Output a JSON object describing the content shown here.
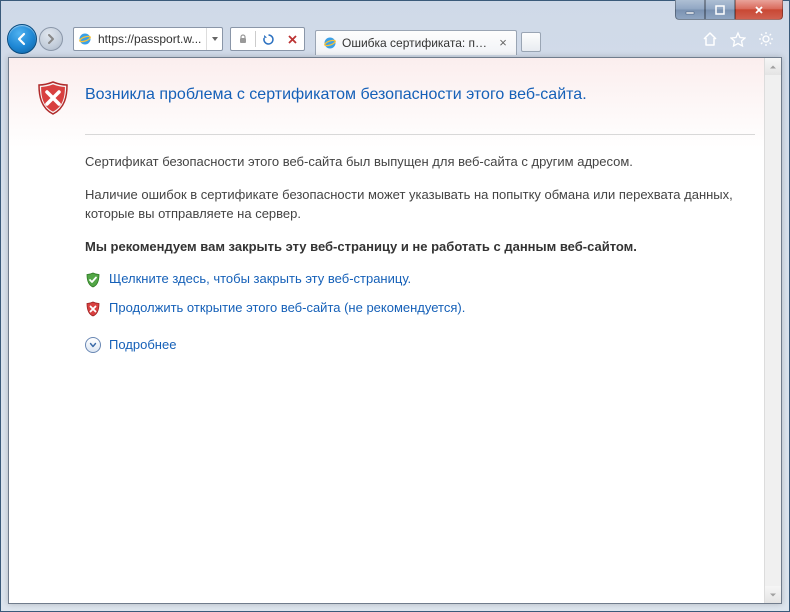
{
  "window": {
    "url": "https://passport.w...",
    "tab_title": "Ошибка сертификата: пер..."
  },
  "page": {
    "title": "Возникла проблема с сертификатом безопасности этого веб-сайта.",
    "paragraph1": "Сертификат безопасности этого веб-сайта был выпущен для веб-сайта с другим адресом.",
    "paragraph2": "Наличие ошибок в сертификате безопасности может указывать на попытку обмана или перехвата данных, которые вы отправляете на сервер.",
    "strong": "Мы рекомендуем вам закрыть эту веб-страницу и не работать с данным веб-сайтом.",
    "link_close": "Щелкните здесь, чтобы закрыть эту веб-страницу.",
    "link_continue": "Продолжить открытие этого веб-сайта (не рекомендуется).",
    "link_more": "Подробнее"
  }
}
